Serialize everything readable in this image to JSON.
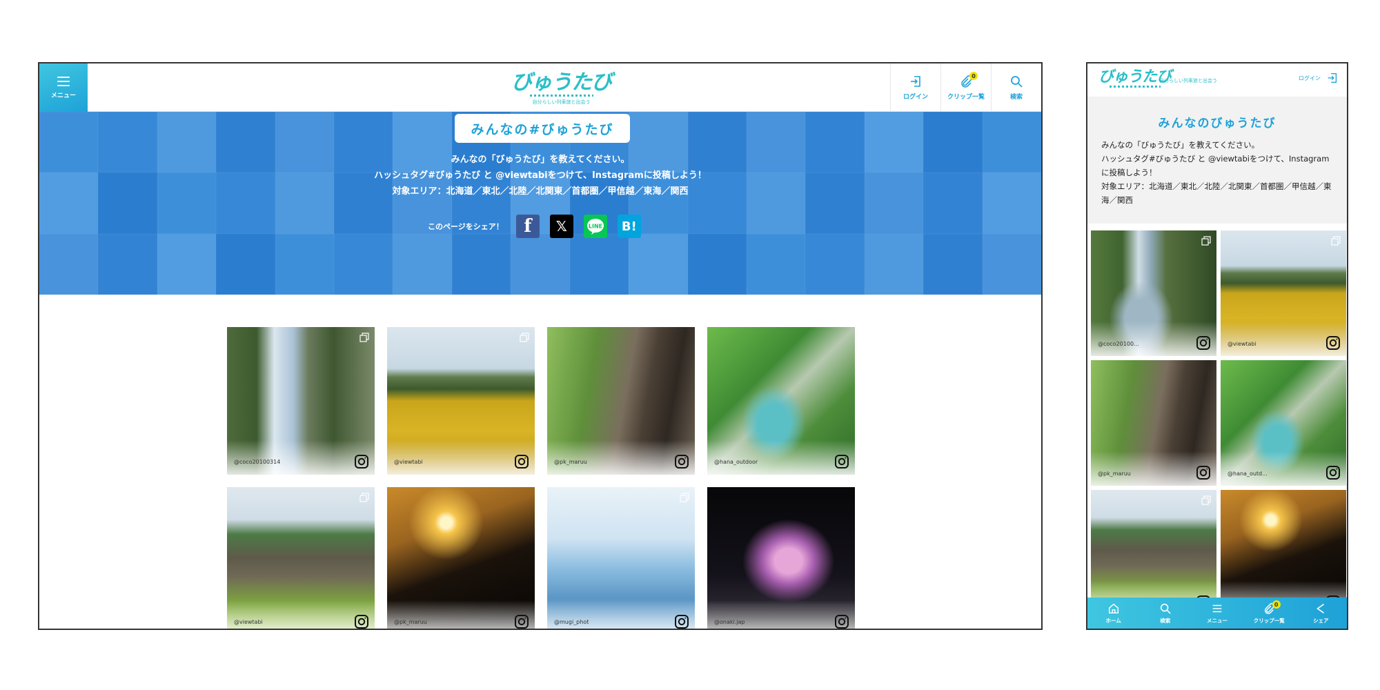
{
  "site": {
    "logo_text": "びゅうたび",
    "tagline": "自分らしい列車旅と出会う"
  },
  "desktop": {
    "menu_label": "メニュー",
    "tools": [
      {
        "label": "ログイン",
        "icon": "login-icon"
      },
      {
        "label": "クリップ一覧",
        "icon": "clip-icon",
        "badge": "0"
      },
      {
        "label": "検索",
        "icon": "search-icon"
      }
    ],
    "hero": {
      "title": "みんなの#びゅうたび",
      "line1": "みんなの「びゅうたび」を教えてください。",
      "line2": "ハッシュタグ#びゅうたび と @viewtabiをつけて、Instagramに投稿しよう！",
      "line3": "対象エリア：北海道／東北／北陸／北関東／首都圏／甲信越／東海／関西",
      "share_label": "このページをシェア！",
      "share_buttons": [
        {
          "name": "facebook",
          "glyph": "f"
        },
        {
          "name": "x",
          "glyph": "𝕏"
        },
        {
          "name": "line",
          "glyph": "LINE"
        },
        {
          "name": "hatena-bookmark",
          "glyph": "B!"
        }
      ]
    },
    "posts": [
      {
        "user": "@coco20100314",
        "multi": true,
        "img": "gorge"
      },
      {
        "user": "@viewtabi",
        "multi": true,
        "img": "sun"
      },
      {
        "user": "@pk_maruu",
        "multi": false,
        "img": "barn"
      },
      {
        "user": "@hana_outdoor",
        "multi": false,
        "img": "falls"
      },
      {
        "user": "@viewtabi",
        "multi": true,
        "img": "village"
      },
      {
        "user": "@pk_maruu",
        "multi": false,
        "img": "silhouette"
      },
      {
        "user": "@mugi_phot",
        "multi": true,
        "img": "sea"
      },
      {
        "user": "@onaki.jap",
        "multi": false,
        "img": "fire"
      }
    ]
  },
  "mobile": {
    "login_label": "ログイン",
    "title": "みんなのびゅうたび",
    "line1": "みんなの「びゅうたび」を教えてください。",
    "line2": "ハッシュタグ#びゅうたび と @viewtabiをつけて、Instagramに投稿しよう！",
    "line3": "対象エリア：北海道／東北／北陸／北関東／首都圏／甲信越／東海／関西",
    "posts": [
      {
        "user": "@coco20100...",
        "multi": true,
        "img": "gorge2"
      },
      {
        "user": "@viewtabi",
        "multi": true,
        "img": "sun"
      },
      {
        "user": "@pk_maruu",
        "multi": false,
        "img": "barn"
      },
      {
        "user": "@hana_outd...",
        "multi": false,
        "img": "falls"
      },
      {
        "user": "",
        "multi": true,
        "img": "village"
      },
      {
        "user": "",
        "multi": false,
        "img": "silhouette"
      }
    ],
    "bottom_nav": [
      {
        "label": "ホーム",
        "icon": "home-icon"
      },
      {
        "label": "検索",
        "icon": "search-icon"
      },
      {
        "label": "メニュー",
        "icon": "menu-icon"
      },
      {
        "label": "クリップ一覧",
        "icon": "clip-icon",
        "badge": "0"
      },
      {
        "label": "シェア",
        "icon": "share-icon"
      }
    ]
  },
  "colors": {
    "brand": "#1ea2d8",
    "brand_light": "#3fc6e0",
    "logo": "#2bbfc8",
    "badge": "#f2e200",
    "line_green": "#06c755",
    "facebook": "#3b5998",
    "hatena": "#00a4de"
  }
}
